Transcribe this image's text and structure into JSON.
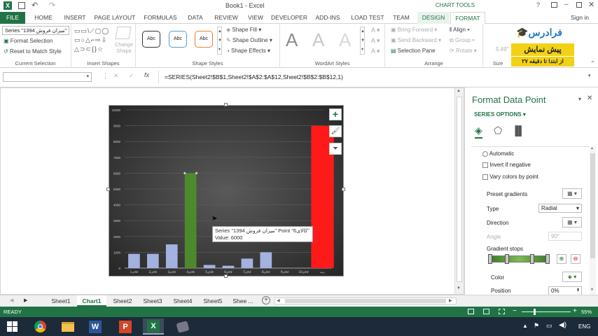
{
  "window": {
    "title": "Book1 - Excel",
    "chart_tools_label": "CHART TOOLS"
  },
  "tabs": [
    "FILE",
    "HOME",
    "INSERT",
    "PAGE LAYOUT",
    "FORMULAS",
    "DATA",
    "REVIEW",
    "VIEW",
    "DEVELOPER",
    "ADD-INS",
    "LOAD TEST",
    "TEAM"
  ],
  "context_tabs": [
    "DESIGN",
    "FORMAT"
  ],
  "user": {
    "sign_in": "Sign in"
  },
  "ribbon": {
    "current_selection": {
      "dropdown_value": "Series \"میزان فروش 1394\"",
      "format_selection": "Format Selection",
      "reset": "Reset to Match Style",
      "label": "Current Selection"
    },
    "insert_shapes": {
      "change_shape": "Change Shape",
      "label": "Insert Shapes"
    },
    "shape_styles": {
      "styles": [
        "Abc",
        "Abc",
        "Abc"
      ],
      "fill": "Shape Fill",
      "outline": "Shape Outline",
      "effects": "Shape Effects",
      "label": "Shape Styles"
    },
    "wordart": {
      "letters": [
        "A",
        "A",
        "A"
      ],
      "label": "WordArt Styles"
    },
    "arrange": {
      "bring_forward": "Bring Forward",
      "send_backward": "Send Backward",
      "selection_pane": "Selection Pane",
      "align": "Align",
      "group": "Group",
      "rotate": "Rotate",
      "label": "Arrange"
    },
    "size": {
      "height": "5.49\"",
      "label": "Size"
    }
  },
  "promo": {
    "brand": "فرادرس",
    "line1": "پیش نمایش",
    "line2": "از ابتدا تا دقیقه ۲۷"
  },
  "formula_bar": {
    "formula": "=SERIES(Sheet2!$B$1,Sheet2!$A$2:$A$12,Sheet2!$B$2:$B$12,1)"
  },
  "chart_data": {
    "type": "bar",
    "categories": [
      "کالای1",
      "کالای2",
      "کالای3",
      "کالای4",
      "کالای5",
      "کالای6",
      "کالای7",
      "کالای8",
      "کالای9",
      "کالای10",
      "رتبه"
    ],
    "series": [
      {
        "name": "میزان فروش 1394",
        "values": [
          900,
          900,
          1500,
          6000,
          200,
          150,
          600,
          1000,
          0,
          0,
          0
        ]
      }
    ],
    "red_bar_value": 9000,
    "ylim": [
      0,
      10000
    ],
    "yticks": [
      "0",
      "1000",
      "2000",
      "3000",
      "4000",
      "5000",
      "6000",
      "7000",
      "8000",
      "9000",
      "10000"
    ],
    "tooltip": {
      "line1": "Series \"میزان فروش 1394\" Point \"کالای6\"",
      "line2": "Value: 6000"
    }
  },
  "pane": {
    "title": "Format Data Point",
    "series_options": "SERIES OPTIONS",
    "automatic": "Automatic",
    "invert": "Invert if negative",
    "vary": "Vary colors by point",
    "preset_gradients": "Preset gradients",
    "type_label": "Type",
    "type_value": "Radial",
    "direction": "Direction",
    "angle_label": "Angle",
    "angle_value": "90°",
    "gradient_stops": "Gradient stops",
    "color_label": "Color",
    "position_label": "Position",
    "position_value": "0%"
  },
  "sheets": [
    "Sheet1",
    "Chart1",
    "Sheet2",
    "Sheet3",
    "Sheet4",
    "Sheet5",
    "Shee ..."
  ],
  "status": {
    "ready": "READY",
    "zoom": "55%"
  },
  "taskbar": {
    "lang": "ENG"
  },
  "colors": {
    "excel_green": "#217346",
    "selected_bar": "#4f8c2c",
    "red_bar": "#ff1a1a",
    "bar_blue": "#a9b8e8"
  }
}
